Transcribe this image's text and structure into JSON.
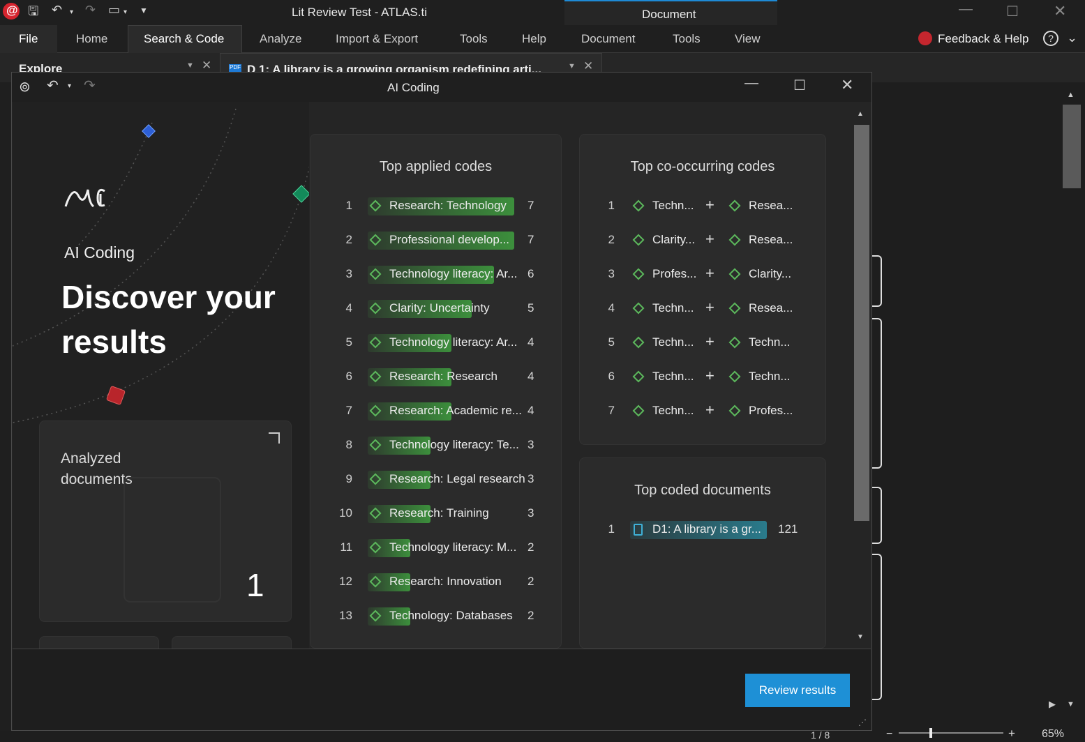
{
  "window": {
    "title": "Lit Review Test - ATLAS.ti",
    "context_tab": "Document",
    "feedback": "Feedback & Help"
  },
  "ribbon": {
    "tabs": [
      "File",
      "Home",
      "Search & Code",
      "Analyze",
      "Import & Export",
      "Tools",
      "Help",
      "Document",
      "Tools",
      "View"
    ],
    "active": "Search & Code"
  },
  "background_tabs": {
    "explore": "Explore",
    "document_tab": "D 1: A library is a growing organism redefining arti..."
  },
  "dialog": {
    "title": "AI Coding",
    "left": {
      "subtitle": "AI Coding",
      "headline_1": "Discover your",
      "headline_2": "results",
      "analyzed_label_1": "Analyzed",
      "analyzed_label_2": "documents",
      "analyzed_count": "1"
    },
    "top_applied": {
      "title": "Top applied codes",
      "rows": [
        {
          "n": "1",
          "name": "Research: Technology",
          "count": "7",
          "fill": 1.0
        },
        {
          "n": "2",
          "name": "Professional develop...",
          "count": "7",
          "fill": 1.0
        },
        {
          "n": "3",
          "name": "Technology literacy: Ar...",
          "count": "6",
          "fill": 0.86
        },
        {
          "n": "4",
          "name": "Clarity: Uncertainty",
          "count": "5",
          "fill": 0.71
        },
        {
          "n": "5",
          "name": "Technology literacy: Ar...",
          "count": "4",
          "fill": 0.57
        },
        {
          "n": "6",
          "name": "Research: Research",
          "count": "4",
          "fill": 0.57
        },
        {
          "n": "7",
          "name": "Research: Academic re...",
          "count": "4",
          "fill": 0.57
        },
        {
          "n": "8",
          "name": "Technology literacy: Te...",
          "count": "3",
          "fill": 0.43
        },
        {
          "n": "9",
          "name": "Research: Legal research",
          "count": "3",
          "fill": 0.43
        },
        {
          "n": "10",
          "name": "Research: Training",
          "count": "3",
          "fill": 0.43
        },
        {
          "n": "11",
          "name": "Technology literacy: M...",
          "count": "2",
          "fill": 0.29
        },
        {
          "n": "12",
          "name": "Research: Innovation",
          "count": "2",
          "fill": 0.29
        },
        {
          "n": "13",
          "name": "Technology: Databases",
          "count": "2",
          "fill": 0.29
        }
      ]
    },
    "top_cooccurring": {
      "title": "Top co-occurring codes",
      "rows": [
        {
          "n": "1",
          "a": "Techn...",
          "b": "Resea..."
        },
        {
          "n": "2",
          "a": "Clarity...",
          "b": "Resea..."
        },
        {
          "n": "3",
          "a": "Profes...",
          "b": "Clarity..."
        },
        {
          "n": "4",
          "a": "Techn...",
          "b": "Resea..."
        },
        {
          "n": "5",
          "a": "Techn...",
          "b": "Techn..."
        },
        {
          "n": "6",
          "a": "Techn...",
          "b": "Techn..."
        },
        {
          "n": "7",
          "a": "Techn...",
          "b": "Profes..."
        }
      ]
    },
    "top_documents": {
      "title": "Top coded documents",
      "rows": [
        {
          "n": "1",
          "name": "D1: A library is a gr...",
          "count": "121"
        }
      ]
    },
    "review_button": "Review results"
  },
  "statusbar": {
    "page": "1 / 8",
    "zoom": "65%"
  },
  "colors": {
    "accent": "#1e90d6",
    "code_bar": "#3c8f3c",
    "doc_bar": "#2a7b8c",
    "code_icon": "#5cb85c"
  }
}
